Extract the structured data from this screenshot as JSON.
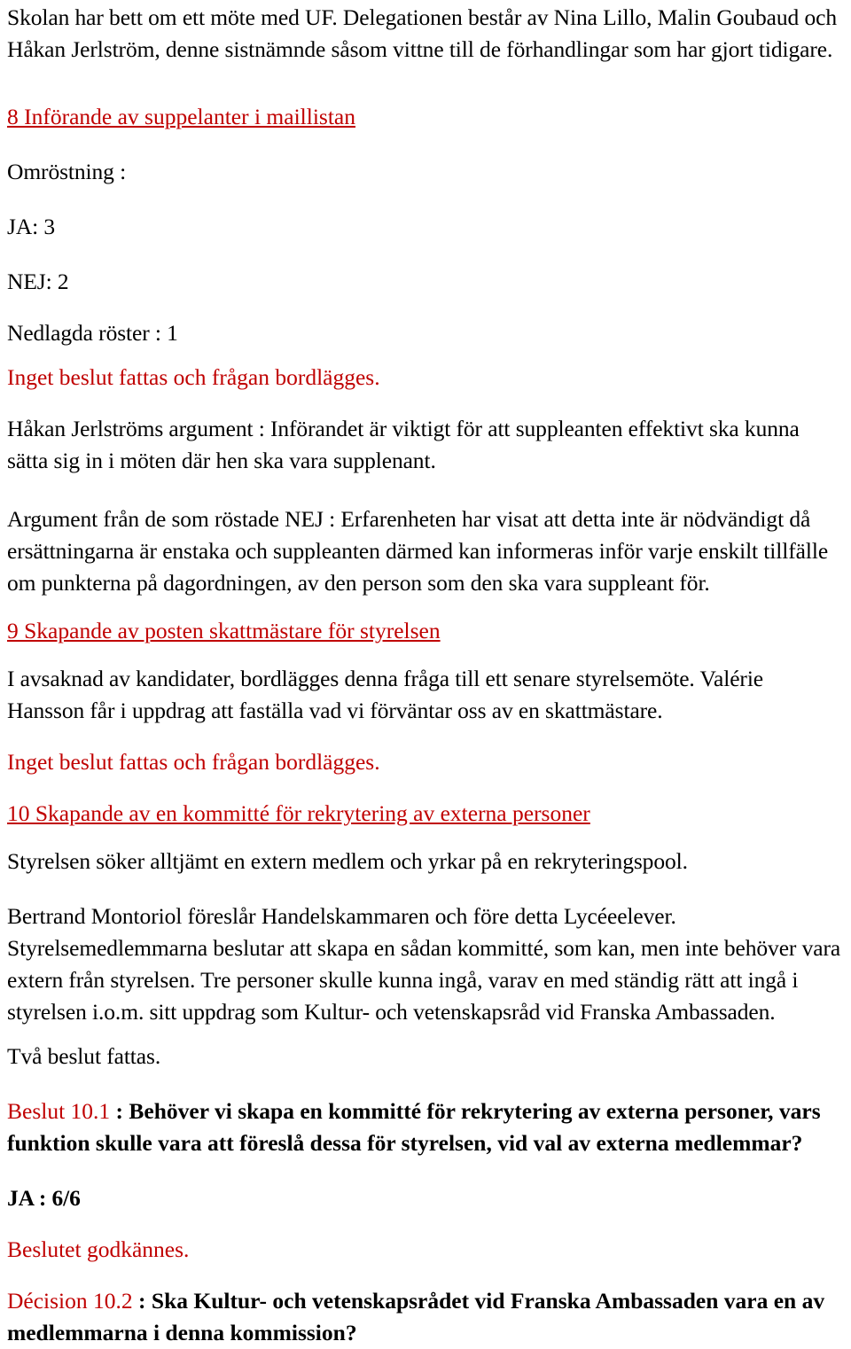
{
  "document": {
    "language": "sv",
    "colors": {
      "text": "#000000",
      "accent_red": "#c00000",
      "background": "#ffffff"
    }
  },
  "intro": {
    "paragraph": "Skolan har bett om ett möte med UF. Delegationen består av Nina Lillo, Malin Goubaud och Håkan Jerlström, denne sistnämnde såsom vittne till de förhandlingar som har gjort tidigare."
  },
  "section_8": {
    "heading": "8 Införande av suppelanter i maillistan",
    "vote_label": "Omröstning :",
    "yes": "JA: 3",
    "no": "NEJ: 2",
    "abstain": "Nedlagda röster : 1",
    "outcome": "Inget beslut fattas och frågan bordlägges.",
    "argument_for": "Håkan Jerlströms argument : Införandet är viktigt för att suppleanten effektivt ska kunna sätta sig in i möten där hen ska vara supplenant.",
    "argument_against": "Argument från de som röstade NEJ : Erfarenheten har visat att detta inte är nödvändigt då ersättningarna är enstaka och suppleanten därmed kan informeras inför varje enskilt tillfälle om punkterna på dagordningen, av den person som den ska vara suppleant för."
  },
  "section_9": {
    "heading": "9 Skapande av posten skattmästare för styrelsen",
    "body": "I avsaknad av kandidater, bordlägges denna fråga till ett senare styrelsemöte. Valérie Hansson får i uppdrag att faställa vad vi förväntar oss av en skattmästare.",
    "outcome": "Inget beslut fattas och frågan bordlägges."
  },
  "section_10": {
    "heading": "10 Skapande av en kommitté för rekrytering av externa personer",
    "body_1": "Styrelsen söker alltjämt en extern medlem och yrkar på en rekryteringspool.",
    "body_2": "Bertrand Montoriol föreslår Handelskammaren och före detta Lycéeelever. Styrelsemedlemmarna beslutar att skapa en sådan kommitté, som kan, men inte behöver vara extern från styrelsen. Tre personer skulle kunna ingå, varav en med ständig rätt att ingå i styrelsen i.o.m. sitt uppdrag som Kultur- och vetenskapsråd vid Franska Ambassaden.",
    "body_3": "Två beslut fattas.",
    "decision_1": {
      "label": "Beslut 10.1",
      "separator": " : ",
      "question": "Behöver vi skapa en kommitté för rekrytering av externa personer, vars funktion skulle vara att föreslå dessa för styrelsen, vid val av externa medlemmar?",
      "vote": "JA : 6/6",
      "outcome": "Beslutet godkännes."
    },
    "decision_2": {
      "label": "Décision 10.2",
      "separator": " : ",
      "question": "Ska Kultur- och vetenskapsrådet vid Franska Ambassaden vara en av medlemmarna i denna kommission?"
    }
  }
}
